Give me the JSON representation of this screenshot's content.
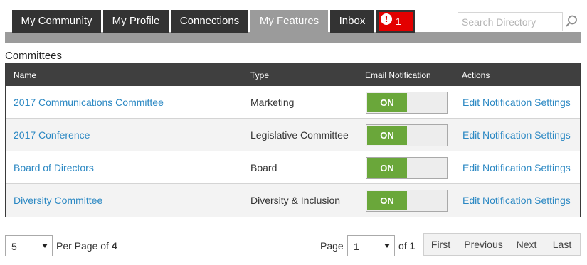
{
  "nav": {
    "tabs": [
      {
        "label": "My Community"
      },
      {
        "label": "My Profile"
      },
      {
        "label": "Connections"
      },
      {
        "label": "My Features",
        "active": true
      },
      {
        "label": "Inbox"
      }
    ],
    "alert": {
      "count": "1",
      "icon": "exclamation-icon",
      "color": "#e30000"
    },
    "search": {
      "placeholder": "Search Directory",
      "icon": "search-icon"
    }
  },
  "section": {
    "title": "Committees"
  },
  "table": {
    "columns": [
      "Name",
      "Type",
      "Email Notification",
      "Actions"
    ],
    "rows": [
      {
        "name": "2017 Communications Committee",
        "type": "Marketing",
        "notification": "ON",
        "action": "Edit Notification Settings"
      },
      {
        "name": "2017 Conference",
        "type": "Legislative Committee",
        "notification": "ON",
        "action": "Edit Notification Settings"
      },
      {
        "name": "Board of Directors",
        "type": "Board",
        "notification": "ON",
        "action": "Edit Notification Settings"
      },
      {
        "name": "Diversity Committee",
        "type": "Diversity & Inclusion",
        "notification": "ON",
        "action": "Edit Notification Settings"
      }
    ]
  },
  "footer": {
    "per_page_value": "5",
    "per_page_label": "Per Page of",
    "total_pages_count": "4",
    "page_label": "Page",
    "page_value": "1",
    "of_label": "of",
    "page_total": "1",
    "pager": {
      "first": "First",
      "previous": "Previous",
      "next": "Next",
      "last": "Last"
    }
  },
  "colors": {
    "toggle_on": "#6aa73a",
    "link": "#2b88c3",
    "header_bg": "#3f3f3f",
    "alert_bg": "#e30000"
  }
}
